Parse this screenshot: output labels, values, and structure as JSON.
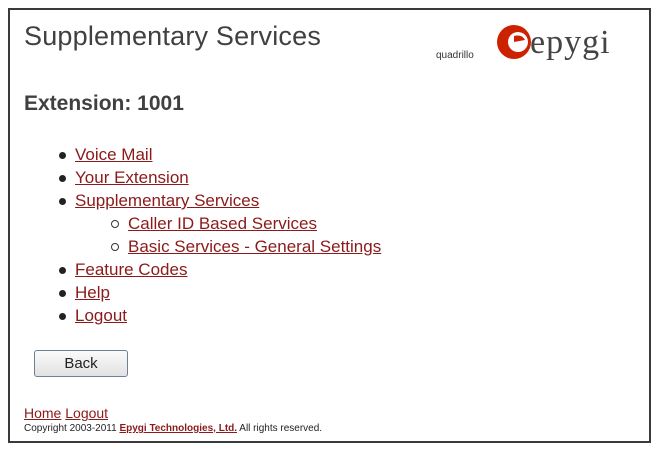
{
  "header": {
    "title": "Supplementary Services",
    "logo": {
      "tagline": "quadrillo",
      "brand": "epygi",
      "mark_color": "#cc2200",
      "icon": "epygi-logo-icon"
    }
  },
  "extension": {
    "title": "Extension: 1001"
  },
  "nav": {
    "items": [
      {
        "label": "Voice Mail"
      },
      {
        "label": "Your Extension"
      },
      {
        "label": "Supplementary Services"
      },
      {
        "label": "Caller ID Based Services"
      },
      {
        "label": "Basic Services - General Settings"
      },
      {
        "label": "Feature Codes"
      },
      {
        "label": "Help"
      },
      {
        "label": "Logout"
      }
    ]
  },
  "back_button": {
    "label": "Back"
  },
  "footer": {
    "home_label": "Home",
    "logout_label": "Logout",
    "copyright_prefix": "Copyright 2003-2011 ",
    "company_label": "Epygi Technologies, Ltd.",
    "copyright_suffix": " All rights reserved."
  },
  "colors": {
    "link": "#8b1a1a",
    "title_text": "#404040",
    "frame_border": "#3a3a3a"
  }
}
